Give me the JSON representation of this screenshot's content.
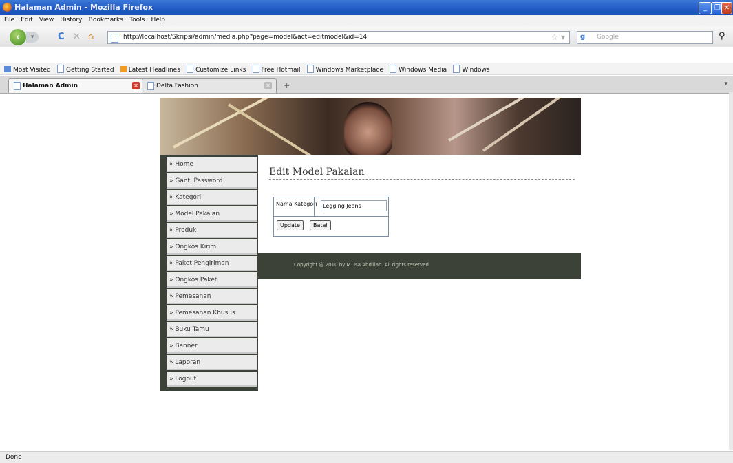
{
  "window": {
    "title": "Halaman Admin - Mozilla Firefox",
    "minimize": "_",
    "maximize": "❐",
    "close": "✕"
  },
  "menu": [
    "File",
    "Edit",
    "View",
    "History",
    "Bookmarks",
    "Tools",
    "Help"
  ],
  "nav": {
    "back": "‹",
    "forward": "▾",
    "reload": "C",
    "stop": "✕",
    "home": "⌂",
    "url": "http://localhost/Skripsi/admin/media.php?page=model&act=editmodel&id=14",
    "search_placeholder": "Google",
    "search_engine": "g"
  },
  "bookmarks": [
    "Most Visited",
    "Getting Started",
    "Latest Headlines",
    "Customize Links",
    "Free Hotmail",
    "Windows Marketplace",
    "Windows Media",
    "Windows"
  ],
  "tabs": [
    {
      "label": "Halaman Admin"
    },
    {
      "label": "Delta Fashion"
    }
  ],
  "sidebar": {
    "items": [
      "» Home",
      "» Ganti Password",
      "» Kategori",
      "» Model Pakaian",
      "» Produk",
      "» Ongkos Kirim",
      "» Paket Pengiriman",
      "» Ongkos Paket",
      "» Pemesanan",
      "» Pemesanan Khusus",
      "» Buku Tamu",
      "» Banner",
      "» Laporan",
      "» Logout"
    ]
  },
  "main": {
    "heading": "Edit Model Pakaian",
    "form": {
      "label": "Nama Kategori",
      "colon": ":",
      "value": "Legging Jeans",
      "update_label": "Update",
      "cancel_label": "Batal"
    }
  },
  "footer": {
    "copyright": "Copyright @ 2010 by M. Isa Abdillah. All rights reserved"
  },
  "status": {
    "text": "Done"
  }
}
